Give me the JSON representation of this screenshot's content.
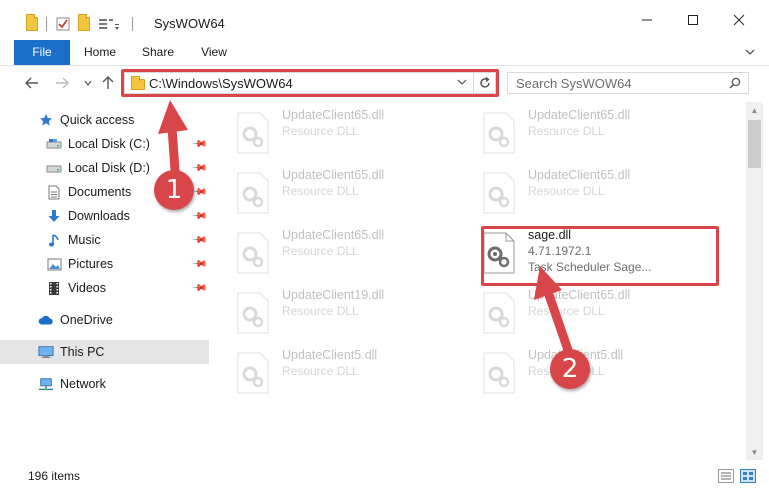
{
  "window": {
    "title": "SysWOW64",
    "minimize_icon": "minimize-icon",
    "maximize_icon": "maximize-icon",
    "close_icon": "close-icon"
  },
  "ribbon": {
    "tabs": [
      {
        "label": "File"
      },
      {
        "label": "Home"
      },
      {
        "label": "Share"
      },
      {
        "label": "View"
      }
    ],
    "expand_icon": "chevron-down-icon"
  },
  "navigation": {
    "address": "C:\\Windows\\SysWOW64",
    "search_placeholder": "Search SysWOW64"
  },
  "sidebar": {
    "items": [
      {
        "label": "Quick access",
        "icon": "star-icon"
      },
      {
        "label": "Local Disk (C:)",
        "icon": "drive-icon",
        "pinned": true
      },
      {
        "label": "Local Disk (D:)",
        "icon": "drive-icon",
        "pinned": true
      },
      {
        "label": "Documents",
        "icon": "document-icon",
        "pinned": true
      },
      {
        "label": "Downloads",
        "icon": "download-icon",
        "pinned": true
      },
      {
        "label": "Music",
        "icon": "music-icon",
        "pinned": true
      },
      {
        "label": "Pictures",
        "icon": "picture-icon",
        "pinned": true
      },
      {
        "label": "Videos",
        "icon": "video-icon",
        "pinned": true
      },
      {
        "label": "OneDrive",
        "icon": "cloud-icon"
      },
      {
        "label": "This PC",
        "icon": "computer-icon",
        "selected": true
      },
      {
        "label": "Network",
        "icon": "network-icon"
      }
    ]
  },
  "files": [
    {
      "name": "UpdateClient65.dll",
      "line2": "Resource DLL",
      "line3": "",
      "faded": true
    },
    {
      "name": "UpdateClient65.dll",
      "line2": "Resource DLL",
      "line3": "",
      "faded": true
    },
    {
      "name": "UpdateClient65.dll",
      "line2": "Resource DLL",
      "line3": "",
      "faded": true
    },
    {
      "name": "UpdateClient65.dll",
      "line2": "Resource DLL",
      "line3": "",
      "faded": true
    },
    {
      "name": "UpdateClient65.dll",
      "line2": "Resource DLL",
      "line3": "",
      "faded": true
    },
    {
      "name": "sage.dll",
      "line2": "4.71.1972.1",
      "line3": "Task Scheduler Sage...",
      "faded": false
    },
    {
      "name": "UpdateClient19.dll",
      "line2": "Resource DLL",
      "line3": "",
      "faded": true
    },
    {
      "name": "UpdateClient65.dll",
      "line2": "Resource DLL",
      "line3": "",
      "faded": true
    },
    {
      "name": "UpdateClient5.dll",
      "line2": "Resource DLL",
      "line3": "",
      "faded": true
    },
    {
      "name": "UpdateClient5.dll",
      "line2": "Resource DLL",
      "line3": "",
      "faded": true
    }
  ],
  "status": {
    "item_count": "196 items"
  },
  "annotations": {
    "step1": "1",
    "step2": "2",
    "color": "#d9464a"
  },
  "colors": {
    "accent": "#1a6fc9",
    "selection": "#e5e5e5"
  }
}
